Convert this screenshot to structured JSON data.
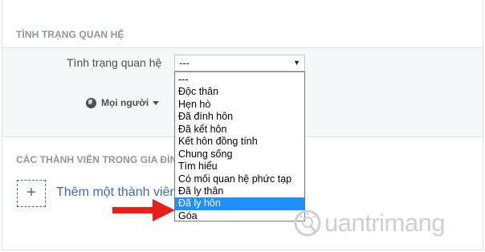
{
  "relationship_section": {
    "title": "TÌNH TRẠNG QUAN HỆ",
    "field_label": "Tình trạng quan hệ",
    "select_value": "---",
    "audience_label": "Mọi người"
  },
  "dropdown": {
    "options": [
      "---",
      "Độc thân",
      "Hẹn hò",
      "Đã đính hôn",
      "Đã kết hôn",
      "Kết hôn đồng tính",
      "Chung sống",
      "Tìm hiểu",
      "Có mối quan hệ phức tạp",
      "Đã ly thân",
      "Đã ly hôn",
      "Góa"
    ],
    "highlighted": "Đã ly hôn"
  },
  "family_section": {
    "title": "CÁC THÀNH VIÊN TRONG GIA ĐÌN",
    "add_icon": "+",
    "add_label": "Thêm một thành viên"
  },
  "annotation": {
    "arrow_color": "#e8201c",
    "icon": "arrow-right-icon"
  },
  "watermark": {
    "text": "uantrimang",
    "icon": "lightbulb-q-icon"
  },
  "colors": {
    "link": "#4267b2",
    "highlight": "#1e90ff",
    "section_title": "#90949c"
  }
}
